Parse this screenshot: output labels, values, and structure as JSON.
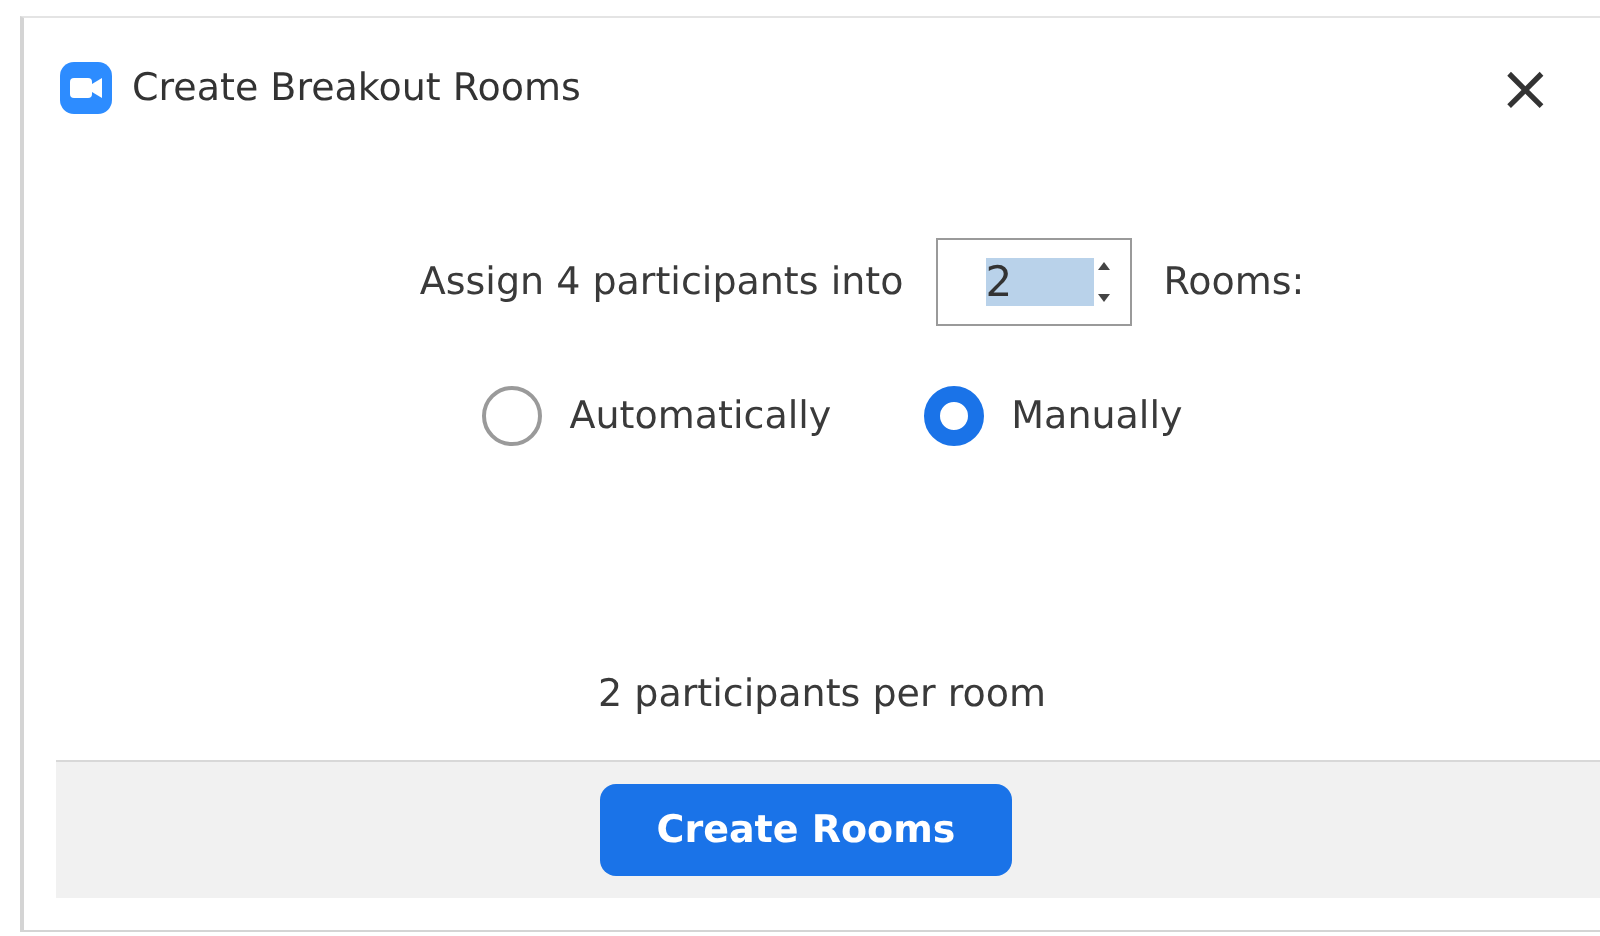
{
  "window": {
    "title": "Create Breakout Rooms",
    "close": "×"
  },
  "assign": {
    "prefix": "Assign 4 participants into",
    "value": "2",
    "value_highlighted": true,
    "suffix": "Rooms:"
  },
  "options": [
    {
      "label": "Automatically",
      "selected": false
    },
    {
      "label": "Manually",
      "selected": true
    }
  ],
  "summary": "2 participants per room",
  "buttons": [
    "Create Rooms"
  ]
}
